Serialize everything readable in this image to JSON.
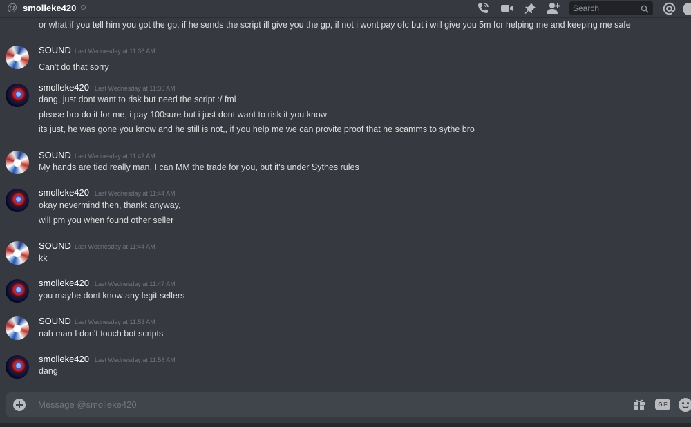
{
  "header": {
    "at_symbol": "@",
    "channel_name": "smolleke420",
    "search_placeholder": "Search",
    "icons": [
      "call-icon",
      "video-icon",
      "pin-icon",
      "add-friend-icon",
      "search-icon",
      "mention-icon",
      "help-icon"
    ]
  },
  "clipped_message": "or what if you tell him you got the gp, if he sends the script ill give you the gp, if not i wont pay ofc but i will give you 5m for helping me and keeping me safe",
  "groups": [
    {
      "author": "SOUND",
      "timestamp": "Last Wednesday at 11:36 AM",
      "avatar": "sound",
      "lines": [
        "Can't do that sorry"
      ]
    },
    {
      "author": "smolleke420",
      "timestamp": "Last Wednesday at 11:36 AM",
      "avatar": "smolleke",
      "lines": [
        "dang, just dont want to risk but need the script :/ fml",
        "please bro do it for me, i pay 100sure but i just dont want to risk it you know",
        "its just, he was gone you know and he still is not,, if you help me we can provite proof that he scamms to sythe bro"
      ]
    },
    {
      "author": "SOUND",
      "timestamp": "Last Wednesday at 11:42 AM",
      "avatar": "sound",
      "lines": [
        "My hands are tied really man, I can MM the trade for you, but it's under Sythes rules"
      ]
    },
    {
      "author": "smolleke420",
      "timestamp": "Last Wednesday at 11:44 AM",
      "avatar": "smolleke",
      "lines": [
        "okay nevermind then, thankt anyway,",
        "will pm you when found other seller"
      ]
    },
    {
      "author": "SOUND",
      "timestamp": "Last Wednesday at 11:44 AM",
      "avatar": "sound",
      "lines": [
        "kk"
      ]
    },
    {
      "author": "smolleke420",
      "timestamp": "Last Wednesday at 11:47 AM",
      "avatar": "smolleke",
      "lines": [
        "you maybe dont know any legit sellers"
      ]
    },
    {
      "author": "SOUND",
      "timestamp": "Last Wednesday at 11:53 AM",
      "avatar": "sound",
      "lines": [
        "nah man I don't touch bot scripts"
      ]
    },
    {
      "author": "smolleke420",
      "timestamp": "Last Wednesday at 11:58 AM",
      "avatar": "smolleke",
      "lines": [
        "dang"
      ]
    }
  ],
  "composer": {
    "placeholder": "Message @smolleke420",
    "gif_label": "GIF"
  },
  "colors": {
    "background": "#36393f",
    "input": "#40444b",
    "text": "#dcddde",
    "timestamp": "#72767d"
  }
}
